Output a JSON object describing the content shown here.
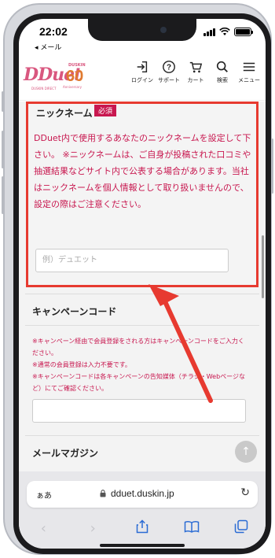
{
  "status": {
    "time": "22:02",
    "back_label": "◂ メール"
  },
  "header": {
    "logo_text": "DDuet",
    "logo_sub": "DUSKIN DIRECT",
    "anniv_top": "DUSKIN",
    "anniv_num": "60",
    "anniv_label": "Anniversary",
    "nav": [
      {
        "label": "ログイン",
        "icon": "login-icon"
      },
      {
        "label": "サポート",
        "icon": "help-icon"
      },
      {
        "label": "カート",
        "icon": "cart-icon"
      },
      {
        "label": "検索",
        "icon": "search-icon"
      },
      {
        "label": "メニュー",
        "icon": "menu-icon"
      }
    ]
  },
  "nickname": {
    "title": "ニックネーム",
    "required": "必須",
    "description": "DDuet内で使用するあなたのニックネームを設定して下さい。 ※ニックネームは、ご自身が投稿された口コミや抽選結果などサイト内で公表する場合があります。当社はニックネームを個人情報として取り扱いませんので、設定の際はご注意ください。",
    "placeholder": "例）デュエット"
  },
  "campaign": {
    "title": "キャンペーンコード",
    "note_lines": [
      "※キャンペーン経由で会員登録をされる方はキャンペーンコードをご入力ください。",
      "※通常の会員登録は入力不要です。",
      "※キャンペーンコードは各キャンペーンの告知媒体（チラシ・Webページなど）にてご確認ください。"
    ]
  },
  "mail": {
    "title": "メールマガジン"
  },
  "safari": {
    "aa": "ぁあ",
    "url": "dduet.duskin.jp"
  },
  "colors": {
    "accent": "#c8174f",
    "highlight": "#e73a30",
    "link_blue": "#2a6bd4"
  }
}
